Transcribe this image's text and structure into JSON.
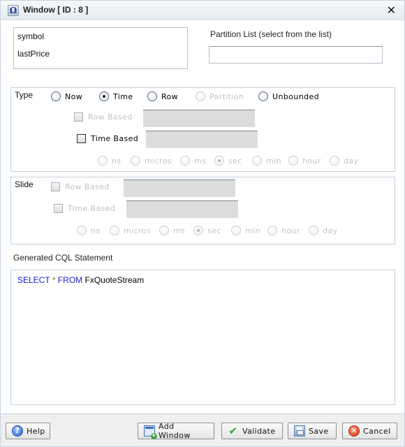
{
  "window": {
    "title": "Window [ ID : 8 ]",
    "title_icon_glyph": "Ω",
    "close_glyph": "✕"
  },
  "fields": {
    "items": [
      "symbol",
      "lastPrice"
    ]
  },
  "partition": {
    "label": "Partition List (select from the list)",
    "value": ""
  },
  "type_group": {
    "label": "Type",
    "options": [
      {
        "label": "Now",
        "selected": false,
        "enabled": true
      },
      {
        "label": "Time",
        "selected": true,
        "enabled": true
      },
      {
        "label": "Row",
        "selected": false,
        "enabled": true
      },
      {
        "label": "Partition",
        "selected": false,
        "enabled": false
      },
      {
        "label": "Unbounded",
        "selected": false,
        "enabled": true
      }
    ],
    "row_based_label": "Row Based",
    "time_based_label": "Time Based",
    "units": [
      {
        "label": "ns",
        "selected": false
      },
      {
        "label": "micros",
        "selected": false
      },
      {
        "label": "ms",
        "selected": false
      },
      {
        "label": "sec",
        "selected": true
      },
      {
        "label": "min",
        "selected": false
      },
      {
        "label": "hour",
        "selected": false
      },
      {
        "label": "day",
        "selected": false
      }
    ]
  },
  "slide_group": {
    "label": "Slide",
    "row_based_label": "Row Based",
    "time_based_label": "Time Based",
    "units": [
      {
        "label": "ns",
        "selected": false
      },
      {
        "label": "micros",
        "selected": false
      },
      {
        "label": "ms",
        "selected": false
      },
      {
        "label": "sec",
        "selected": true
      },
      {
        "label": "min",
        "selected": false
      },
      {
        "label": "hour",
        "selected": false
      },
      {
        "label": "day",
        "selected": false
      }
    ]
  },
  "cql": {
    "label": "Generated CQL Statement",
    "kw_select": "SELECT",
    "star": "*",
    "kw_from": "FROM",
    "source": "FxQuoteStream"
  },
  "footer": {
    "help": "Help",
    "add_window": "Add Window",
    "validate": "Validate",
    "save": "Save",
    "cancel": "Cancel",
    "help_glyph": "?",
    "validate_glyph": "✔",
    "cancel_glyph": "✕"
  }
}
